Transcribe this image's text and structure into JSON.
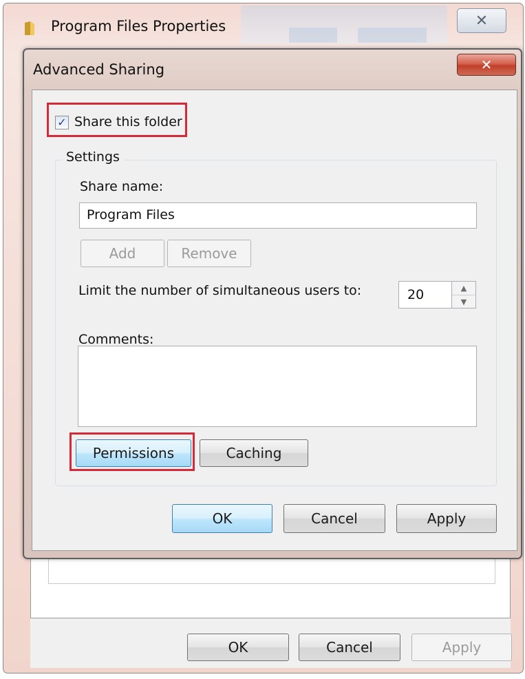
{
  "back_window": {
    "title": "Program Files Properties",
    "close_symbol": "✕",
    "icon": "folder-icon",
    "buttons": {
      "ok": "OK",
      "cancel": "Cancel",
      "apply": "Apply"
    }
  },
  "dialog": {
    "title": "Advanced Sharing",
    "close_symbol": "✕",
    "share_checkbox": {
      "label": "Share this folder",
      "checked": true,
      "mark": "✓"
    },
    "settings": {
      "legend": "Settings",
      "share_name_label": "Share name:",
      "share_name_value": "Program Files",
      "add_label": "Add",
      "remove_label": "Remove",
      "limit_label": "Limit the number of simultaneous users to:",
      "limit_value": "20",
      "spin_up": "▲",
      "spin_down": "▼",
      "comments_label": "Comments:",
      "comments_value": "",
      "permissions_label": "Permissions",
      "caching_label": "Caching"
    },
    "buttons": {
      "ok": "OK",
      "cancel": "Cancel",
      "apply": "Apply"
    }
  },
  "colors": {
    "highlight": "#d42a37",
    "close_button": "#c0402a",
    "default_button": "#3c7fb1"
  }
}
